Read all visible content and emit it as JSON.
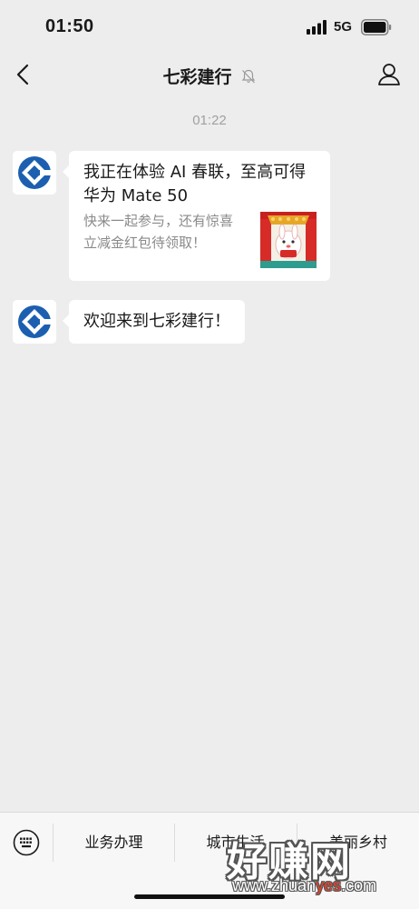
{
  "status_bar": {
    "time": "01:50",
    "network": "5G"
  },
  "nav": {
    "title": "七彩建行"
  },
  "chat": {
    "timestamp": "01:22",
    "messages": [
      {
        "type": "card",
        "title": "我正在体验 AI 春联，至高可得华为 Mate 50",
        "description": "快来一起参与，还有惊喜立减金红包待领取！"
      },
      {
        "type": "text",
        "text": "欢迎来到七彩建行！"
      }
    ]
  },
  "bottom_menu": {
    "items": [
      "业务办理",
      "城市生活",
      "美丽乡村"
    ]
  },
  "watermark": {
    "main": "好赚网",
    "sub_prefix": "www.zhuan",
    "sub_highlight": "yes",
    "sub_suffix": ".com"
  },
  "colors": {
    "background": "#ededed",
    "bubble": "#ffffff",
    "brand_blue": "#1c5fb0",
    "muted_text": "#8a8a8a"
  },
  "icons": [
    "back-icon",
    "mute-icon",
    "profile-icon",
    "ccb-logo-icon",
    "keyboard-icon",
    "signal-icon",
    "battery-icon"
  ]
}
